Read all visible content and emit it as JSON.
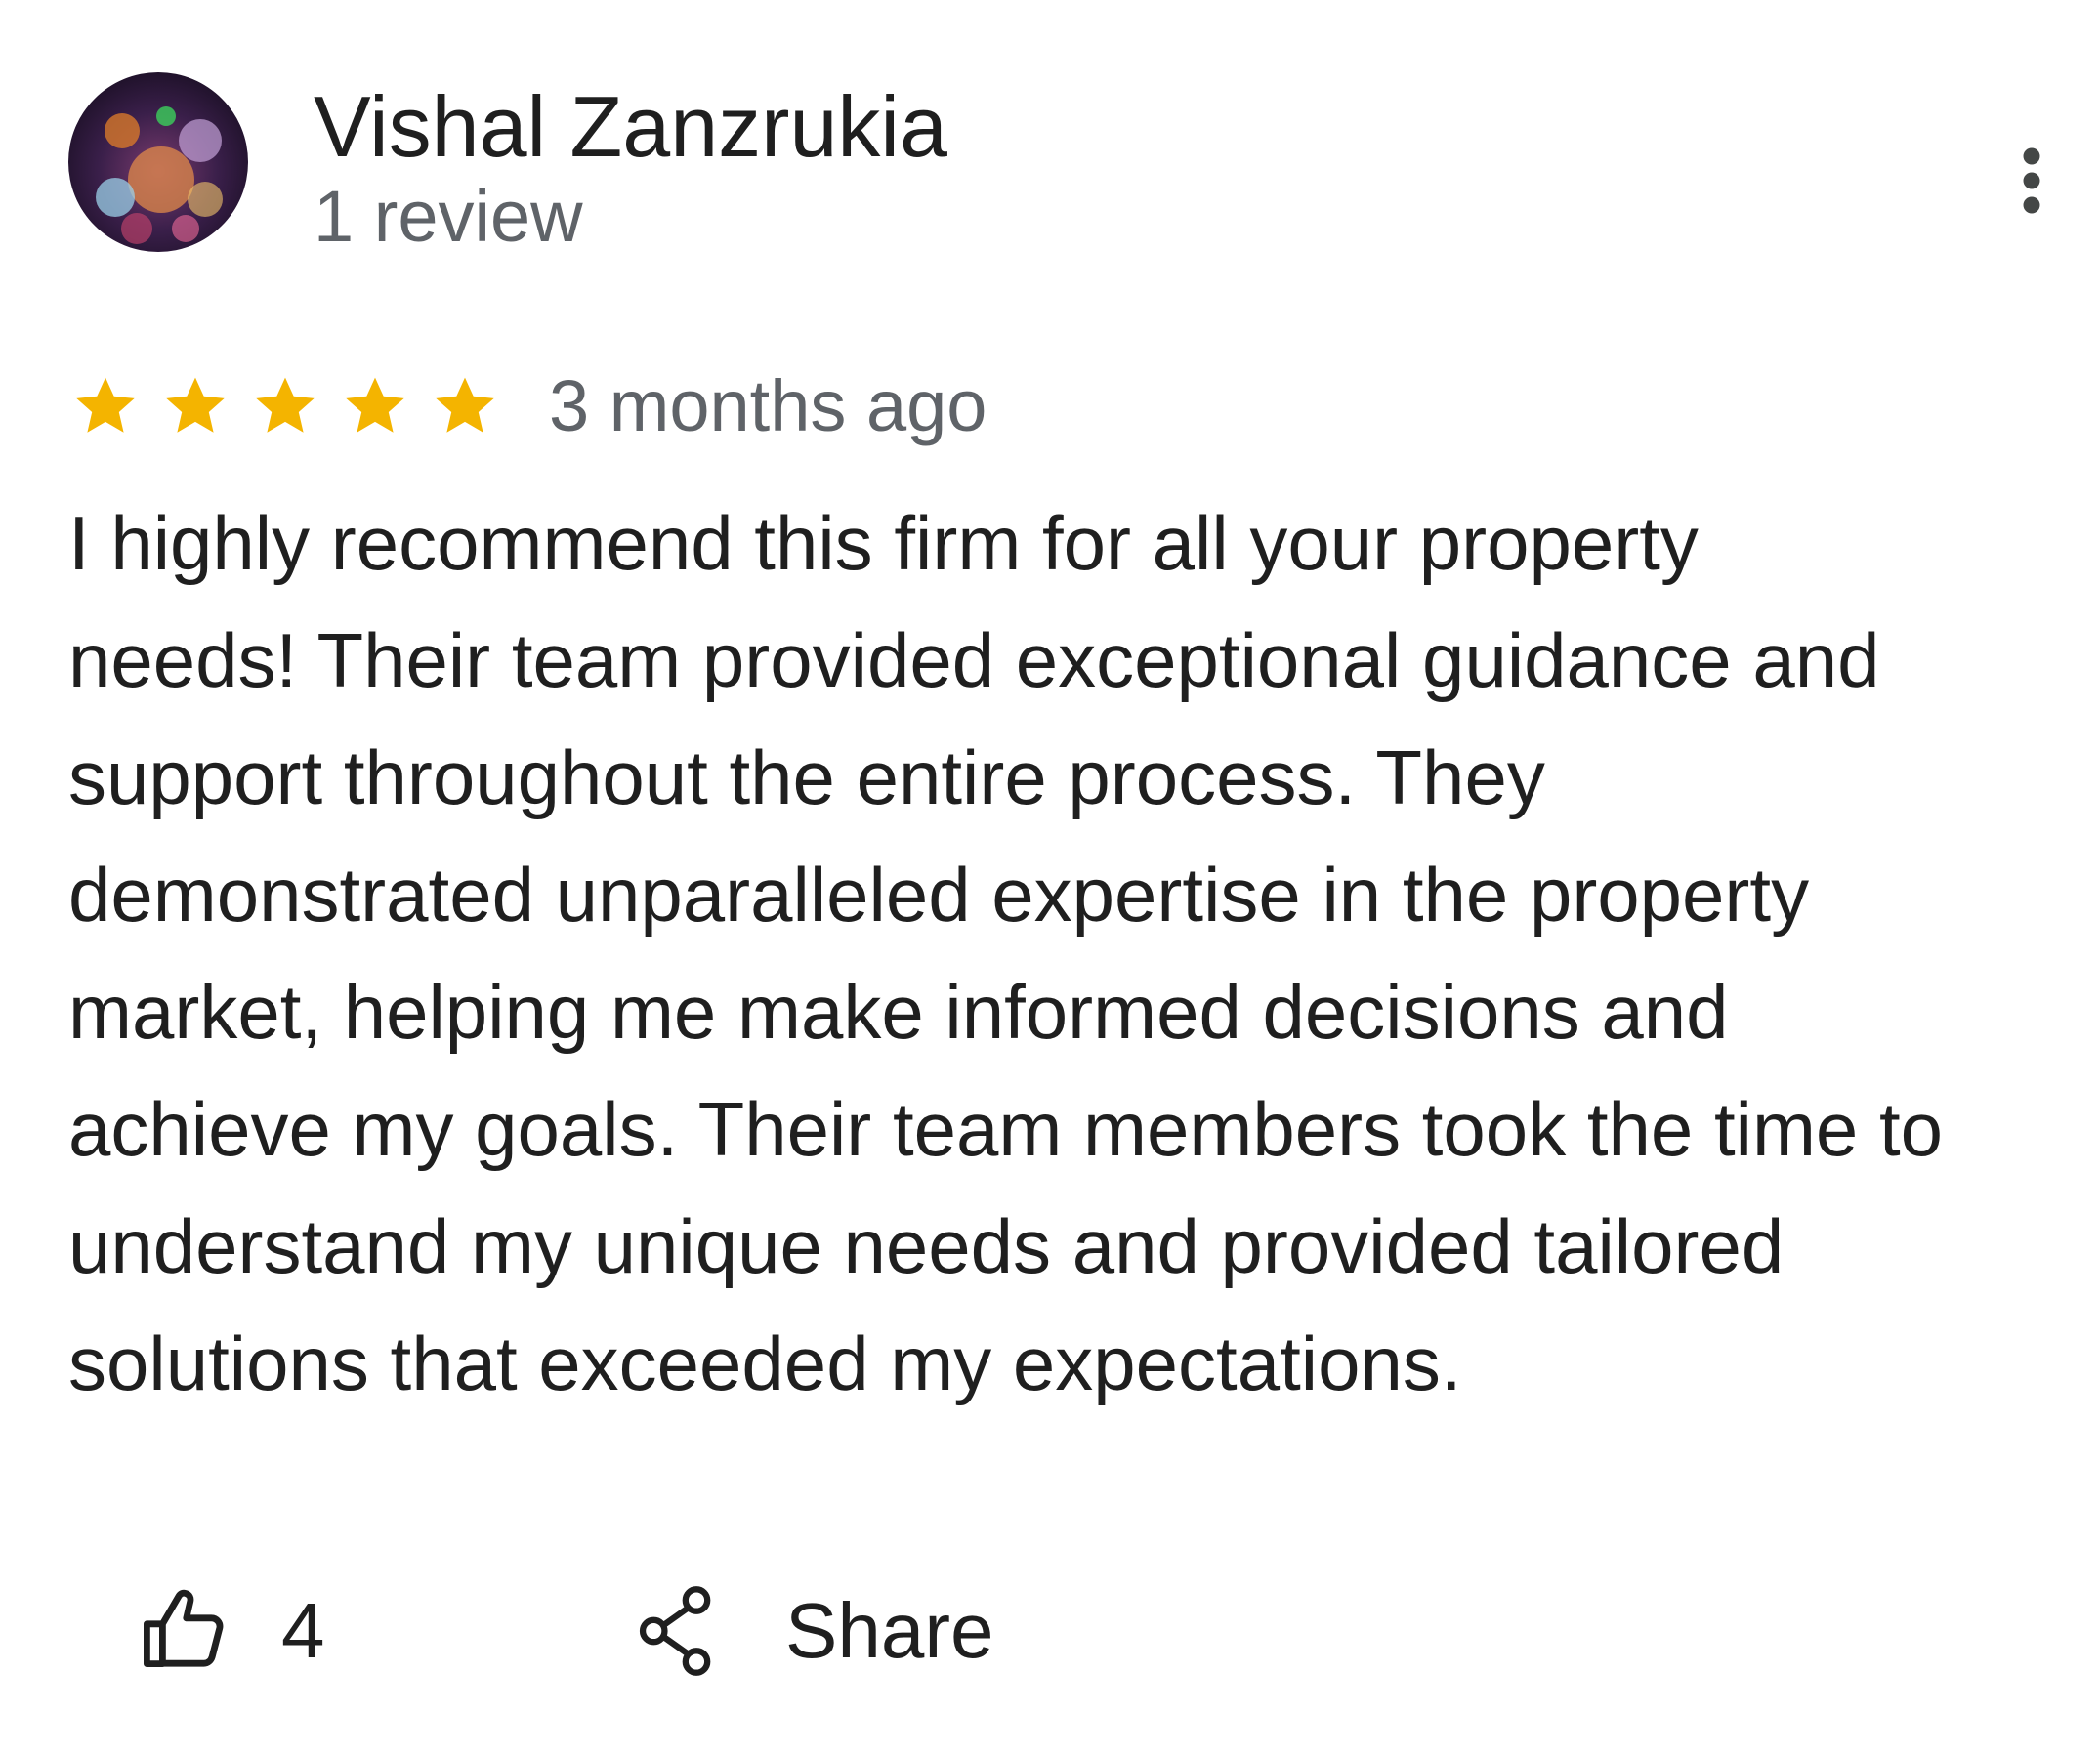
{
  "review": {
    "author_name": "Vishal Zanzrukia",
    "author_review_count": "1 review",
    "rating": 5,
    "rating_max": 5,
    "date": "3 months ago",
    "text": "I highly recommend this firm for all your property\nneeds! Their team provided exceptional guidance and\nsupport throughout the entire process. They\ndemonstrated unparalleled expertise in the property\nmarket, helping me make informed decisions and\nachieve my goals. Their team members took the time to\nunderstand my unique needs and provided tailored\nsolutions that exceeded my expectations."
  },
  "actions": {
    "like_count": "4",
    "share_label": "Share"
  },
  "icons": {
    "more": "more-vert-icon",
    "like": "thumb-up-icon",
    "share": "share-icon",
    "star": "star-icon"
  },
  "colors": {
    "star": "#F4B400",
    "text_primary": "#1F1F1F",
    "text_secondary": "#5F6368"
  }
}
